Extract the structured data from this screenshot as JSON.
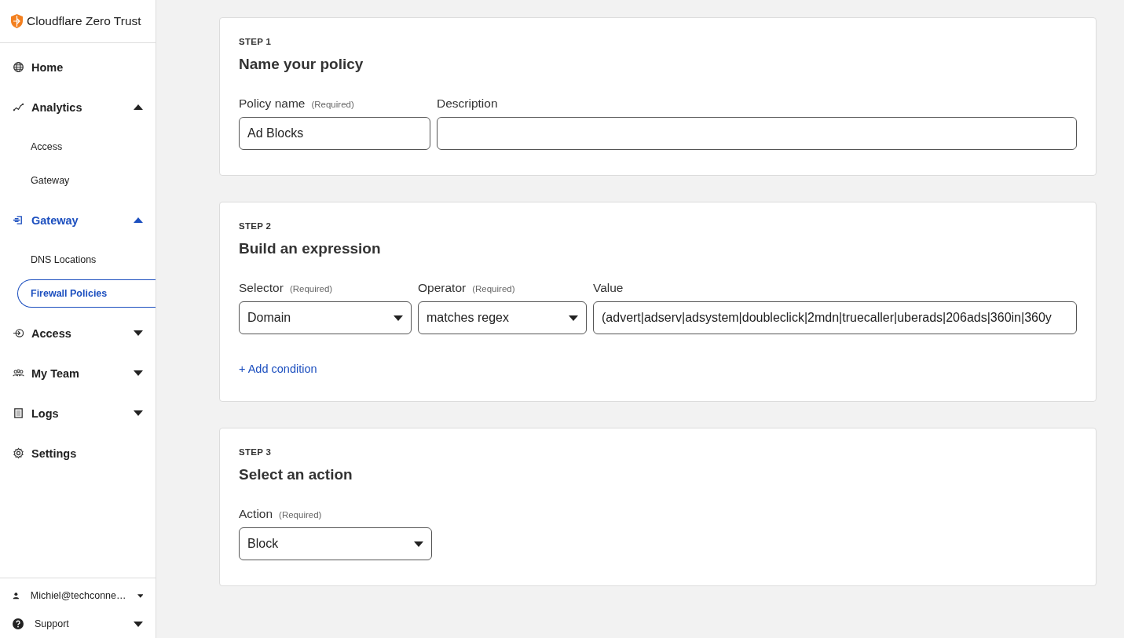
{
  "sidebar": {
    "brand": "Cloudflare Zero Trust",
    "items": [
      {
        "kind": "link",
        "label": "Home",
        "selected": false
      },
      {
        "kind": "group",
        "label": "Analytics",
        "selected": false,
        "expanded": true,
        "children": [
          {
            "label": "Access",
            "selected": false
          },
          {
            "label": "Gateway",
            "selected": false
          }
        ]
      },
      {
        "kind": "group",
        "label": "Gateway",
        "selected": true,
        "expanded": true,
        "children": [
          {
            "label": "DNS Locations",
            "selected": false
          },
          {
            "label": "Firewall Policies",
            "selected": true
          }
        ]
      },
      {
        "kind": "group",
        "label": "Access",
        "selected": false,
        "expanded": false
      },
      {
        "kind": "group",
        "label": "My Team",
        "selected": false,
        "expanded": false
      },
      {
        "kind": "group",
        "label": "Logs",
        "selected": false,
        "expanded": false
      },
      {
        "kind": "link",
        "label": "Settings",
        "selected": false
      }
    ],
    "footer": [
      {
        "kind": "user",
        "label": "Michiel@techconne…"
      },
      {
        "kind": "help",
        "label": "Support"
      }
    ]
  },
  "steps": [
    {
      "step": "STEP 1",
      "title": "Name your policy",
      "fields": [
        {
          "kind": "text",
          "label": "Policy name",
          "note": "(Required)",
          "value": "Ad Blocks"
        },
        {
          "kind": "text",
          "label": "Description"
        }
      ]
    },
    {
      "step": "STEP 2",
      "title": "Build an expression",
      "fields": [
        {
          "kind": "select",
          "label": "Selector",
          "note": "(Required)",
          "value": "Domain"
        },
        {
          "kind": "select",
          "label": "Operator",
          "note": "(Required)",
          "value": "matches regex"
        },
        {
          "kind": "text",
          "label": "Value",
          "value": "(advert|adserv|adsystem|doubleclick|2mdn|truecaller|uberads|206ads|360in|360y"
        }
      ],
      "link": "+ Add condition"
    },
    {
      "step": "STEP 3",
      "title": "Select an action",
      "fields": [
        {
          "kind": "select",
          "label": "Action",
          "note": "(Required)",
          "value": "Block"
        }
      ]
    }
  ]
}
